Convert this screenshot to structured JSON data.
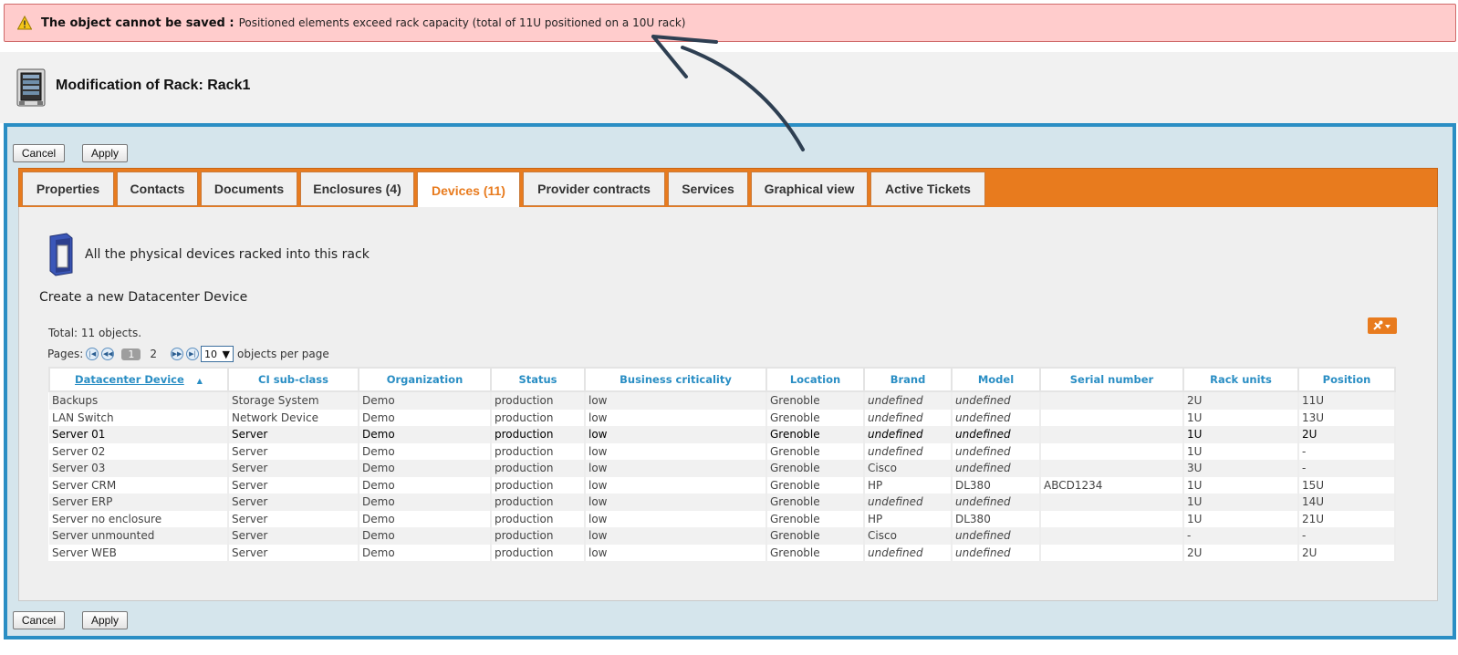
{
  "alert": {
    "title": "The object cannot be saved :",
    "message": "Positioned elements exceed rack capacity (total of 11U positioned on a 10U rack)"
  },
  "page": {
    "title": "Modification of Rack: Rack1"
  },
  "buttons": {
    "cancel": "Cancel",
    "apply": "Apply"
  },
  "tabs": [
    {
      "label": "Properties"
    },
    {
      "label": "Contacts"
    },
    {
      "label": "Documents"
    },
    {
      "label": "Enclosures (4)"
    },
    {
      "label": "Devices (11)"
    },
    {
      "label": "Provider contracts"
    },
    {
      "label": "Services"
    },
    {
      "label": "Graphical view"
    },
    {
      "label": "Active Tickets"
    }
  ],
  "active_tab": "Devices (11)",
  "devices": {
    "description": "All the physical devices racked into this rack",
    "create_link": "Create a new Datacenter Device",
    "total": "Total: 11 objects.",
    "pages_label": "Pages:",
    "current_page": "1",
    "other_page": "2",
    "per_page_value": "10",
    "per_page_label": "objects per page",
    "columns": [
      "Datacenter Device",
      "CI sub-class",
      "Organization",
      "Status",
      "Business criticality",
      "Location",
      "Brand",
      "Model",
      "Serial number",
      "Rack units",
      "Position"
    ],
    "rows": [
      [
        "Backups",
        "Storage System",
        "Demo",
        "production",
        "low",
        "Grenoble",
        "undefined",
        "undefined",
        "",
        "2U",
        "11U"
      ],
      [
        "LAN Switch",
        "Network Device",
        "Demo",
        "production",
        "low",
        "Grenoble",
        "undefined",
        "undefined",
        "",
        "1U",
        "13U"
      ],
      [
        "Server 01",
        "Server",
        "Demo",
        "production",
        "low",
        "Grenoble",
        "undefined",
        "undefined",
        "",
        "1U",
        "2U"
      ],
      [
        "Server 02",
        "Server",
        "Demo",
        "production",
        "low",
        "Grenoble",
        "undefined",
        "undefined",
        "",
        "1U",
        "-"
      ],
      [
        "Server 03",
        "Server",
        "Demo",
        "production",
        "low",
        "Grenoble",
        "Cisco",
        "undefined",
        "",
        "3U",
        "-"
      ],
      [
        "Server CRM",
        "Server",
        "Demo",
        "production",
        "low",
        "Grenoble",
        "HP",
        "DL380",
        "ABCD1234",
        "1U",
        "15U"
      ],
      [
        "Server ERP",
        "Server",
        "Demo",
        "production",
        "low",
        "Grenoble",
        "undefined",
        "undefined",
        "",
        "1U",
        "14U"
      ],
      [
        "Server no enclosure",
        "Server",
        "Demo",
        "production",
        "low",
        "Grenoble",
        "HP",
        "DL380",
        "",
        "1U",
        "21U"
      ],
      [
        "Server unmounted",
        "Server",
        "Demo",
        "production",
        "low",
        "Grenoble",
        "Cisco",
        "undefined",
        "",
        "-",
        "-"
      ],
      [
        "Server WEB",
        "Server",
        "Demo",
        "production",
        "low",
        "Grenoble",
        "undefined",
        "undefined",
        "",
        "2U",
        "2U"
      ]
    ]
  },
  "colors": {
    "accent": "#e87b1e",
    "frame": "#2a8ec4",
    "alert_bg": "#ffcccc",
    "link": "#2a8ec4"
  },
  "icons": [
    "warning-icon",
    "rack-icon",
    "device-icon",
    "tools-icon",
    "first-page-icon",
    "prev-page-icon",
    "next-page-icon",
    "last-page-icon",
    "sort-asc-icon",
    "annotation-arrow"
  ]
}
